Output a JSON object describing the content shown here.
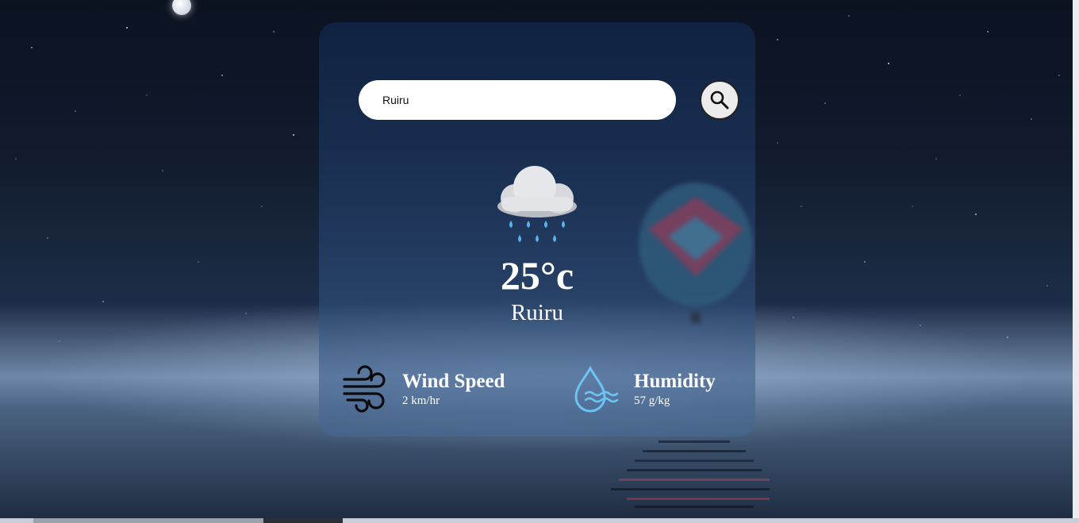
{
  "search": {
    "value": "Ruiru",
    "icon": "search-icon"
  },
  "weather": {
    "icon": "rain-cloud-icon",
    "temperature": "25°c",
    "city": "Ruiru"
  },
  "details": {
    "wind": {
      "icon": "wind-icon",
      "label": "Wind Speed",
      "value": "2 km/hr"
    },
    "humidity": {
      "icon": "humidity-icon",
      "label": "Humidity",
      "value": "57 g/kg"
    }
  },
  "colors": {
    "text": "#ffffff",
    "rain_drop": "#58b4ef",
    "humidity_icon": "#6cc3f4",
    "card_background": "#1a3358"
  }
}
